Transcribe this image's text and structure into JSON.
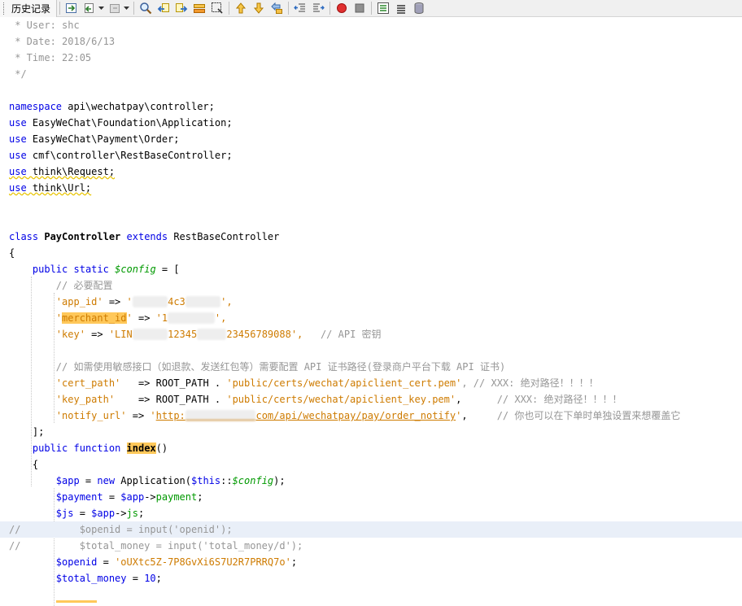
{
  "toolbar": {
    "history_tab": "历史记录",
    "icons": [
      "source-icon",
      "back-history-icon",
      "forward-history-icon",
      "last-edit-icon",
      "find-icon",
      "find-previous-icon",
      "find-next-icon",
      "toggle-highlight-icon",
      "find-selection-icon",
      "previous-bookmark-icon",
      "next-bookmark-icon",
      "toggle-bookmark-icon",
      "shift-left-icon",
      "shift-right-icon",
      "record-macro-icon",
      "stop-macro-icon",
      "comment-icon",
      "uncomment-icon",
      "database-icon"
    ]
  },
  "code": {
    "l0": " * User: shc",
    "l1": " * Date: 2018/6/13",
    "l2": " * Time: 22:05",
    "l3": " */",
    "ns_kw": "namespace",
    "ns_path": " api\\wechatpay\\controller;",
    "use_kw": "use",
    "use1": " EasyWeChat\\Foundation\\Application;",
    "use2": " EasyWeChat\\Payment\\Order;",
    "use3": " cmf\\controller\\RestBaseController;",
    "use4": " think\\Request;",
    "use5": " think\\Url;",
    "class_kw": "class",
    "class_name": "PayController",
    "extends_kw": "extends",
    "parent_class": "RestBaseController",
    "open_brace": "{",
    "public_kw": "public",
    "static_kw": "static",
    "config_var": "$config",
    "config_open": " = [",
    "c_required": "// 必要配置",
    "k_app_id": "'app_id'",
    "arrow": " => ",
    "v_app_id_a": "'",
    "v_app_id_b": "4c3",
    "v_app_id_c": "',",
    "k_merchant": "merchant_id",
    "v_merchant_a": "'1",
    "v_merchant_c": "',",
    "k_key": "'key'",
    "v_key_a": "'LIN",
    "v_key_b": "12345",
    "v_key_c": "23456789088',",
    "c_key": "// API 密钥",
    "c_cert": "// 如需使用敏感接口（如退款、发送红包等）需要配置 API 证书路径(登录商户平台下载 API 证书)",
    "k_cert": "'cert_path'",
    "arrow_pad": "   => ",
    "root_path": "ROOT_PATH",
    "dot": " . ",
    "v_cert": "'public/certs/wechat/apiclient_cert.pem'",
    "c_cert_note": ", // XXX: 绝对路径！！！！",
    "k_keypath": "'key_path'",
    "arrow_pad2": "    => ",
    "v_keypath": "'public/certs/wechat/apiclient_key.pem'",
    "c_keypath_note": "// XXX: 绝对路径！！！！",
    "k_notify": "'notify_url'",
    "v_notify_a": "'",
    "v_notify_link_a": "http:",
    "v_notify_link_b": "com/api/wechatpay/pay/order_notify",
    "v_notify_c": "'",
    "c_notify": "// 你也可以在下单时单独设置来想覆盖它",
    "close_arr": "];",
    "function_kw": "function",
    "index_name": "index",
    "parens": "()",
    "app_var": "$app",
    "eq": " = ",
    "new_kw": "new",
    "app_ctor": " Application(",
    "this_var": "$this",
    "dcolon": "::",
    "ctor_end": ");",
    "payment_var": "$payment",
    "payment_prop": "payment",
    "js_var": "$js",
    "js_prop": "js",
    "obj_arrow": "->",
    "semi": ";",
    "comment_slash": "//",
    "openid_cmt": "$openid = input('openid');",
    "total_cmt": "$total_money = input('total_money/d');",
    "openid_var": "$openid",
    "openid_val": "'oUXtc5Z-7P8GvXi6S7U2R7PRRQ7o'",
    "total_var": "$total_money",
    "total_val": "10"
  }
}
